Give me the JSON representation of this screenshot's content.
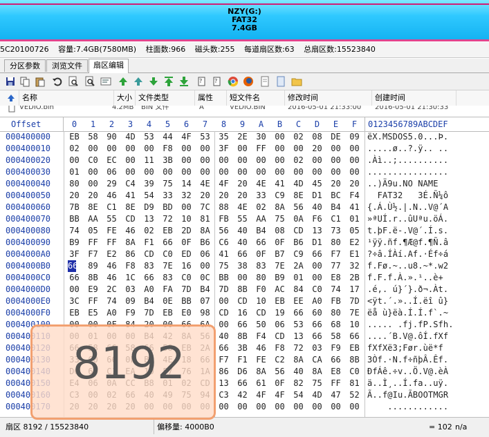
{
  "disk": {
    "name": "NZY(G:)",
    "fs": "FAT32",
    "size": "7.4GB"
  },
  "info": {
    "serial": "5C20100726",
    "capacity": "容量:7.4GB(7580MB)",
    "cylinders": "柱面数:966",
    "heads": "磁头数:255",
    "sectors_per_track": "每道扇区数:63",
    "total_sectors": "总扇区数:15523840"
  },
  "tabs": [
    {
      "label": "分区参数"
    },
    {
      "label": "浏览文件"
    },
    {
      "label": "扇区编辑"
    }
  ],
  "toolbar_icons": [
    "save-icon",
    "copy-icon",
    "paste-icon",
    "undo-icon",
    "search-icon",
    "find-next-icon",
    "text-search-icon",
    "goto-top-icon",
    "goto-down-icon",
    "goto-first-icon",
    "goto-last-icon",
    "bookmark-icon",
    "bookmark2-icon",
    "chrome-icon",
    "firefox-icon",
    "page-icon",
    "document-icon",
    "folder-icon"
  ],
  "list": {
    "headers": [
      "名称",
      "大小",
      "文件类型",
      "属性",
      "短文件名",
      "修改时间",
      "创建时间"
    ],
    "row": [
      "VEDIO.bin",
      "4.2MB",
      "BIN 文件",
      "A",
      "VEDIO.BIN",
      "2016-05-01 21:33:00",
      "2016-05-01 21:30:33"
    ]
  },
  "hex": {
    "offset_label": "Offset",
    "col_headers": [
      "0",
      "1",
      "2",
      "3",
      "4",
      "5",
      "6",
      "7",
      "8",
      "9",
      "A",
      "B",
      "C",
      "D",
      "E",
      "F"
    ],
    "ascii_header": "0123456789ABCDEF",
    "rows": [
      {
        "offset": "000400000",
        "bytes": [
          "EB",
          "58",
          "90",
          "4D",
          "53",
          "44",
          "4F",
          "53",
          "35",
          "2E",
          "30",
          "00",
          "02",
          "08",
          "DE",
          "09"
        ],
        "ascii": "ëX.MSDOS5.0...Þ."
      },
      {
        "offset": "000400010",
        "bytes": [
          "02",
          "00",
          "00",
          "00",
          "00",
          "F8",
          "00",
          "00",
          "3F",
          "00",
          "FF",
          "00",
          "00",
          "20",
          "00",
          "00"
        ],
        "ascii": ".....ø..?.ÿ.. .."
      },
      {
        "offset": "000400020",
        "bytes": [
          "00",
          "C0",
          "EC",
          "00",
          "11",
          "3B",
          "00",
          "00",
          "00",
          "00",
          "00",
          "00",
          "02",
          "00",
          "00",
          "00"
        ],
        "ascii": ".Àì..;.........."
      },
      {
        "offset": "000400030",
        "bytes": [
          "01",
          "00",
          "06",
          "00",
          "00",
          "00",
          "00",
          "00",
          "00",
          "00",
          "00",
          "00",
          "00",
          "00",
          "00",
          "00"
        ],
        "ascii": "................"
      },
      {
        "offset": "000400040",
        "bytes": [
          "80",
          "00",
          "29",
          "C4",
          "39",
          "75",
          "14",
          "4E",
          "4F",
          "20",
          "4E",
          "41",
          "4D",
          "45",
          "20",
          "20"
        ],
        "ascii": "..)Ä9u.NO NAME  "
      },
      {
        "offset": "000400050",
        "bytes": [
          "20",
          "20",
          "46",
          "41",
          "54",
          "33",
          "32",
          "20",
          "20",
          "20",
          "33",
          "C9",
          "8E",
          "D1",
          "BC",
          "F4"
        ],
        "ascii": "  FAT32   3É.Ñ¼ô"
      },
      {
        "offset": "000400060",
        "bytes": [
          "7B",
          "8E",
          "C1",
          "8E",
          "D9",
          "BD",
          "00",
          "7C",
          "88",
          "4E",
          "02",
          "8A",
          "56",
          "40",
          "B4",
          "41"
        ],
        "ascii": "{.Á.Ù½.|.N..V@´A"
      },
      {
        "offset": "000400070",
        "bytes": [
          "BB",
          "AA",
          "55",
          "CD",
          "13",
          "72",
          "10",
          "81",
          "FB",
          "55",
          "AA",
          "75",
          "0A",
          "F6",
          "C1",
          "01"
        ],
        "ascii": "»ªUÍ.r..ûUªu.öÁ."
      },
      {
        "offset": "000400080",
        "bytes": [
          "74",
          "05",
          "FE",
          "46",
          "02",
          "EB",
          "2D",
          "8A",
          "56",
          "40",
          "B4",
          "08",
          "CD",
          "13",
          "73",
          "05"
        ],
        "ascii": "t.þF.ë-.V@´.Í.s."
      },
      {
        "offset": "000400090",
        "bytes": [
          "B9",
          "FF",
          "FF",
          "8A",
          "F1",
          "66",
          "0F",
          "B6",
          "C6",
          "40",
          "66",
          "0F",
          "B6",
          "D1",
          "80",
          "E2"
        ],
        "ascii": "¹ÿÿ.ñf.¶Æ@f.¶Ñ.â"
      },
      {
        "offset": "0004000A0",
        "bytes": [
          "3F",
          "F7",
          "E2",
          "86",
          "CD",
          "C0",
          "ED",
          "06",
          "41",
          "66",
          "0F",
          "B7",
          "C9",
          "66",
          "F7",
          "E1"
        ],
        "ascii": "?÷â.ÍÀí.Af.·Éf÷á"
      },
      {
        "offset": "0004000B0",
        "bytes": [
          "66",
          "89",
          "46",
          "F8",
          "83",
          "7E",
          "16",
          "00",
          "75",
          "38",
          "83",
          "7E",
          "2A",
          "00",
          "77",
          "32"
        ],
        "ascii": "f.Fø.~..u8.~*.w2"
      },
      {
        "offset": "0004000C0",
        "bytes": [
          "66",
          "8B",
          "46",
          "1C",
          "66",
          "83",
          "C0",
          "0C",
          "BB",
          "00",
          "80",
          "B9",
          "01",
          "00",
          "E8",
          "2B"
        ],
        "ascii": "f.F.f.À.».¹..è+"
      },
      {
        "offset": "0004000D0",
        "bytes": [
          "00",
          "E9",
          "2C",
          "03",
          "A0",
          "FA",
          "7D",
          "B4",
          "7D",
          "8B",
          "F0",
          "AC",
          "84",
          "C0",
          "74",
          "17"
        ],
        "ascii": ".é,. ú}´}.ð¬.Àt."
      },
      {
        "offset": "0004000E0",
        "bytes": [
          "3C",
          "FF",
          "74",
          "09",
          "B4",
          "0E",
          "BB",
          "07",
          "00",
          "CD",
          "10",
          "EB",
          "EE",
          "A0",
          "FB",
          "7D"
        ],
        "ascii": "<ÿt.´.»..Í.ëî û}"
      },
      {
        "offset": "0004000F0",
        "bytes": [
          "EB",
          "E5",
          "A0",
          "F9",
          "7D",
          "EB",
          "E0",
          "98",
          "CD",
          "16",
          "CD",
          "19",
          "66",
          "60",
          "80",
          "7E"
        ],
        "ascii": "ëå ù}ëà.Í.Í.f`.~"
      },
      {
        "offset": "000400100",
        "bytes": [
          "00",
          "00",
          "0F",
          "84",
          "20",
          "00",
          "66",
          "6A",
          "00",
          "66",
          "50",
          "06",
          "53",
          "66",
          "68",
          "10"
        ],
        "ascii": "..... .fj.fP.Sfh."
      },
      {
        "offset": "000400110",
        "bytes": [
          "00",
          "01",
          "00",
          "00",
          "B4",
          "42",
          "8A",
          "56",
          "40",
          "8B",
          "F4",
          "CD",
          "13",
          "66",
          "58",
          "66"
        ],
        "ascii": "....´B.V@.ôÍ.fXf"
      },
      {
        "offset": "000400120",
        "bytes": [
          "66",
          "58",
          "66",
          "58",
          "66",
          "58",
          "EB",
          "2A",
          "66",
          "3B",
          "46",
          "F8",
          "72",
          "03",
          "F9",
          "EB"
        ],
        "ascii": "fXfXë3;Før.ùë*f"
      },
      {
        "offset": "000400130",
        "bytes": [
          "33",
          "C0",
          "66",
          "0F",
          "B7",
          "4E",
          "18",
          "66",
          "F7",
          "F1",
          "FE",
          "C2",
          "8A",
          "CA",
          "66",
          "8B"
        ],
        "ascii": "3Òf.·N.f÷ñþÂ.Êf."
      },
      {
        "offset": "000400140",
        "bytes": [
          "D0",
          "66",
          "C1",
          "EA",
          "10",
          "F7",
          "76",
          "1A",
          "86",
          "D6",
          "8A",
          "56",
          "40",
          "8A",
          "E8",
          "C0"
        ],
        "ascii": "ÐfÁê.÷v..Ö.V@.èÀ"
      },
      {
        "offset": "000400150",
        "bytes": [
          "E4",
          "06",
          "0A",
          "CC",
          "B8",
          "01",
          "02",
          "CD",
          "13",
          "66",
          "61",
          "0F",
          "82",
          "75",
          "FF",
          "81"
        ],
        "ascii": "ä..Ì¸..Í.fa..uÿ."
      },
      {
        "offset": "000400160",
        "bytes": [
          "C3",
          "00",
          "02",
          "66",
          "40",
          "49",
          "75",
          "94",
          "C3",
          "42",
          "4F",
          "4F",
          "54",
          "4D",
          "47",
          "52"
        ],
        "ascii": "Ã..f@Iu.ÃBOOTMGR"
      },
      {
        "offset": "000400170",
        "bytes": [
          "20",
          "20",
          "20",
          "20",
          "00",
          "00",
          "00",
          "00",
          "00",
          "00",
          "00",
          "00",
          "00",
          "00",
          "00",
          "00"
        ],
        "ascii": "    ............"
      }
    ]
  },
  "status": {
    "sector": "扇区 8192 / 15523840",
    "offset": "偏移量:   4000B0",
    "value": "= 102",
    "na": "n/a"
  },
  "overlay": {
    "value": "8192"
  }
}
